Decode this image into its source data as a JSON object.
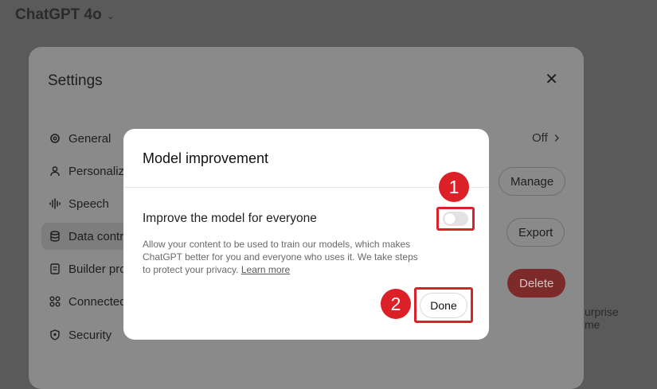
{
  "app": {
    "title": "ChatGPT 4o"
  },
  "settings": {
    "title": "Settings",
    "close_glyph": "✕",
    "sidebar": [
      {
        "label": "General",
        "icon": "gear-icon"
      },
      {
        "label": "Personaliza",
        "icon": "person-icon"
      },
      {
        "label": "Speech",
        "icon": "waveform-icon"
      },
      {
        "label": "Data contro",
        "icon": "database-icon"
      },
      {
        "label": "Builder pro",
        "icon": "id-card-icon"
      },
      {
        "label": "Connected",
        "icon": "apps-grid-icon"
      },
      {
        "label": "Security",
        "icon": "shield-icon"
      }
    ],
    "row_value": "Off",
    "row_chevron": "›",
    "manage_label": "Manage",
    "export_label": "Export",
    "delete_label": "Delete",
    "partial_text": "urprise me"
  },
  "modal": {
    "title": "Model improvement",
    "option_label": "Improve the model for everyone",
    "toggle_state": "off",
    "description_lines": [
      "Allow your content to be used to train our models, which makes",
      "ChatGPT better for you and everyone who uses it. We take steps",
      "to protect your privacy."
    ],
    "learn_more": "Learn more",
    "done_label": "Done"
  },
  "annotations": {
    "badge_1": "1",
    "badge_2": "2"
  },
  "colors": {
    "annotation_red": "#dc2027",
    "delete_red": "#7c2a2a",
    "modal_bg": "#ffffff"
  }
}
